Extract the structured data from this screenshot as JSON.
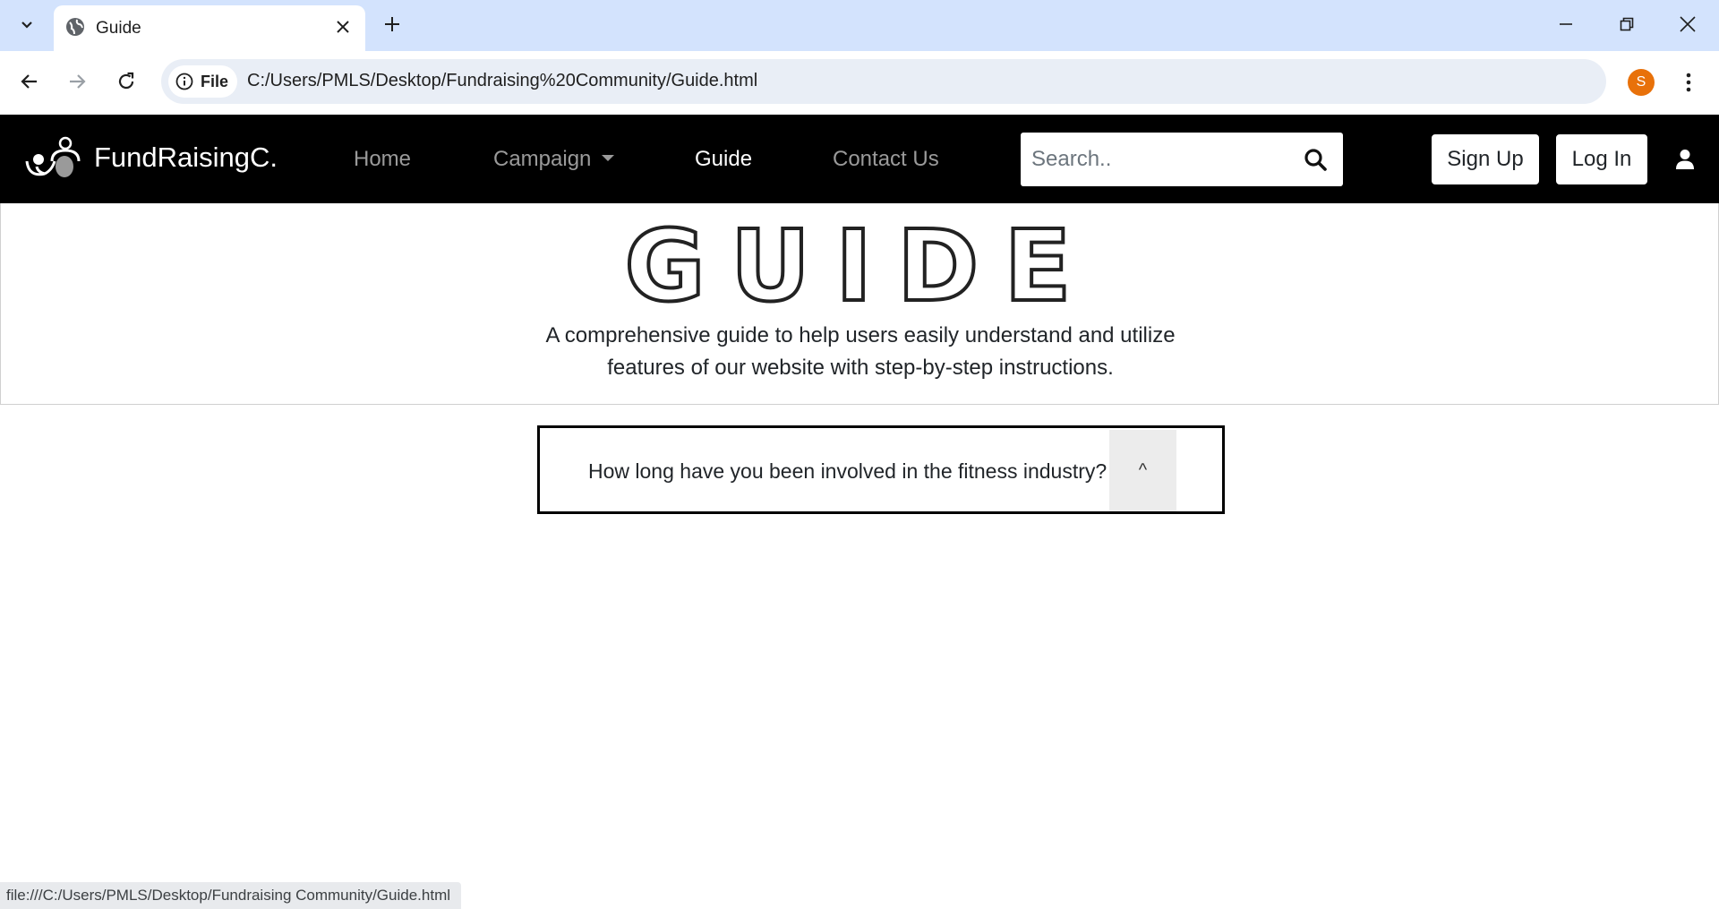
{
  "browser": {
    "tab_title": "Guide",
    "site_chip_label": "File",
    "url": "C:/Users/PMLS/Desktop/Fundraising%20Community/Guide.html",
    "profile_initial": "S",
    "status_url": "file:///C:/Users/PMLS/Desktop/Fundraising Community/Guide.html",
    "icons": [
      "tab-search-icon",
      "globe-icon",
      "close-icon",
      "plus-icon",
      "minimize-icon",
      "restore-icon",
      "window-close-icon",
      "back-arrow-icon",
      "forward-arrow-icon",
      "reload-icon",
      "info-icon",
      "star-icon",
      "kebab-menu-icon"
    ]
  },
  "navbar": {
    "brand": "FundRaisingC.",
    "links": {
      "home": "Home",
      "campaign": "Campaign",
      "guide": "Guide",
      "contact": "Contact Us"
    },
    "search_placeholder": "Search..",
    "signup": "Sign Up",
    "login": "Log In",
    "icons": [
      "brand-logo-icon",
      "caret-down-icon",
      "search-icon",
      "user-icon"
    ]
  },
  "hero": {
    "title": "GUIDE",
    "description": "A comprehensive guide to help users easily understand and utilize features of our website with step-by-step instructions."
  },
  "faq": {
    "question": "How long have you been involved in the fitness industry?",
    "toggle": "^"
  },
  "colors": {
    "tabstrip": "#d3e3fd",
    "navbar": "#000000",
    "profile": "#e8710a",
    "toggle_bg": "#ececec"
  }
}
